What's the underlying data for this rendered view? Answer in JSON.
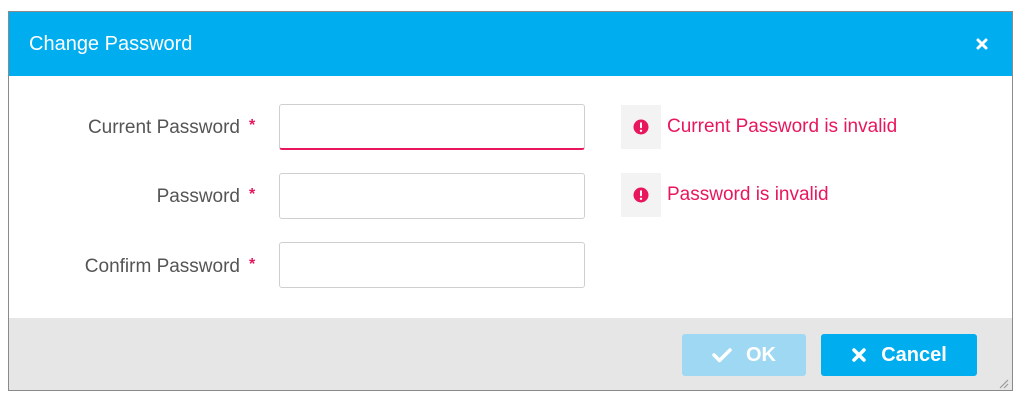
{
  "dialog": {
    "title": "Change Password",
    "close_icon": "close-icon",
    "fields": [
      {
        "label": "Current Password",
        "required_mark": "*",
        "value": "",
        "error": "Current Password is invalid"
      },
      {
        "label": "Password",
        "required_mark": "*",
        "value": "",
        "error": "Password is invalid"
      },
      {
        "label": "Confirm Password",
        "required_mark": "*",
        "value": "",
        "error": ""
      }
    ],
    "buttons": {
      "ok_label": "OK",
      "ok_icon": "checkmark-icon",
      "cancel_label": "Cancel",
      "cancel_icon": "close-icon"
    }
  },
  "colors": {
    "header": "#00aeef",
    "error": "#e8175d",
    "ok_disabled": "#9fd8f2",
    "footer": "#e6e6e6"
  }
}
